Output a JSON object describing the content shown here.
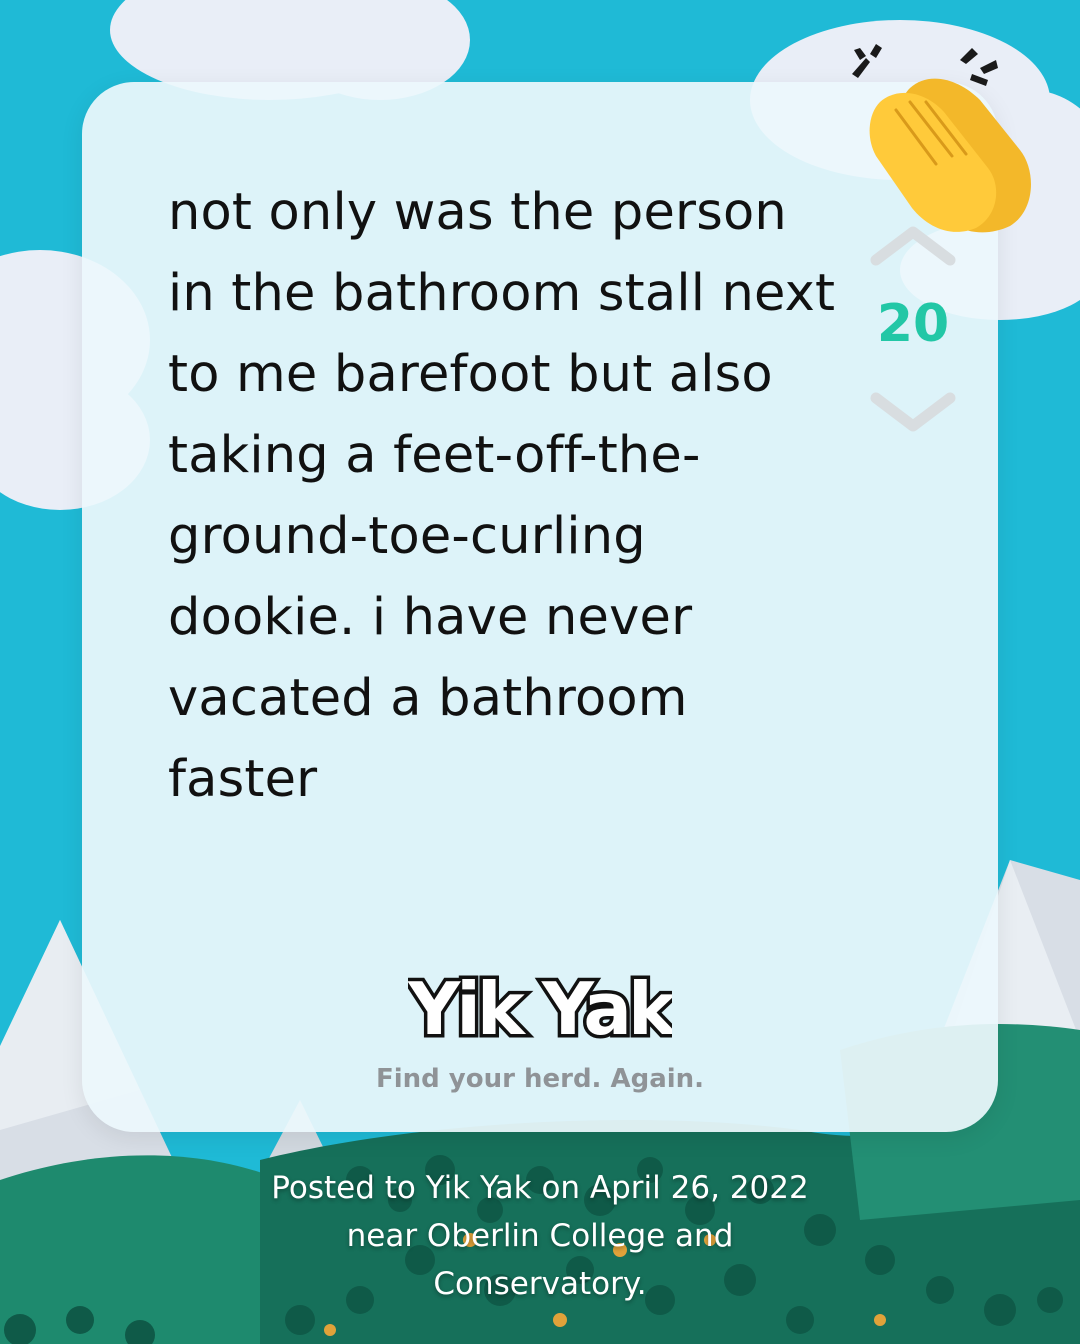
{
  "post": {
    "text": "not only was the person in the bathroom stall next to me barefoot but also taking a feet-off-the-ground-toe-curling dookie. i have never vacated a bathroom faster"
  },
  "votes": {
    "count": "20",
    "up_icon": "chevron-up-icon",
    "down_icon": "chevron-down-icon"
  },
  "brand": {
    "logo_text": "Yik Yak",
    "tagline": "Find your herd. Again."
  },
  "footer": {
    "line1": "Posted to Yik Yak on April 26, 2022",
    "line2": "near Oberlin College and",
    "line3": "Conservatory."
  },
  "colors": {
    "background": "#1fbad6",
    "vote_count": "#22c7a6",
    "card": "#ecf8fc",
    "mountain_green": "#1e8a6e"
  },
  "decor": {
    "emoji": "clapping-hands-icon"
  }
}
